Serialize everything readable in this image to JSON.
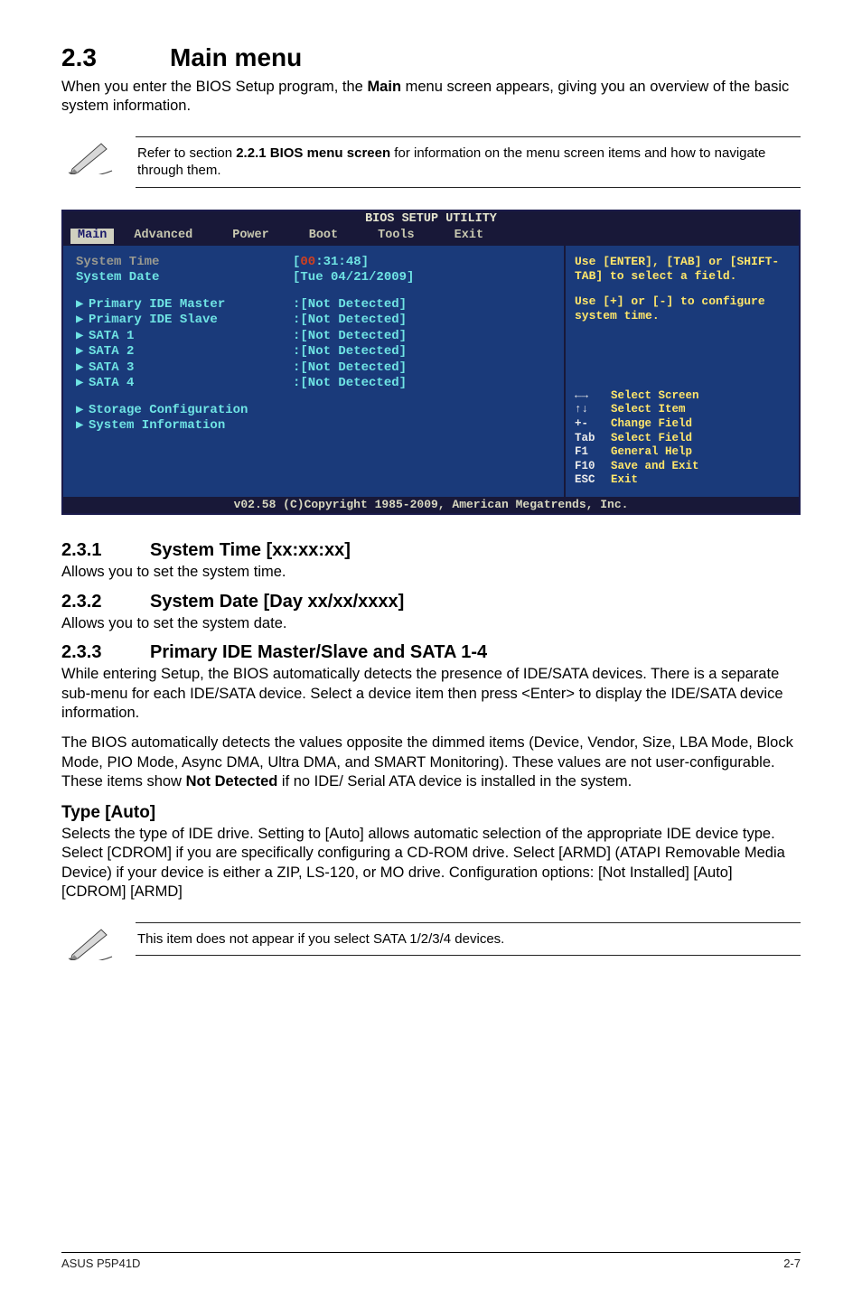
{
  "heading": {
    "num": "2.3",
    "title": "Main menu"
  },
  "intro": "When you enter the BIOS Setup program, the ",
  "intro_bold": "Main",
  "intro_tail": " menu screen appears, giving you an overview of the basic system information.",
  "note1_a": "Refer to section ",
  "note1_b": "2.2.1 BIOS menu screen",
  "note1_c": " for information on the menu screen items and how to navigate through them.",
  "bios": {
    "title": "BIOS SETUP UTILITY",
    "tabs": [
      "Main",
      "Advanced",
      "Power",
      "Boot",
      "Tools",
      "Exit"
    ],
    "sys_time_label": "System Time",
    "sys_date_label": "System Date",
    "sys_time_val_open": "[",
    "sys_time_val_hh": "00",
    "sys_time_val_rest": ":31:48]",
    "sys_date_val": "[Tue 04/21/2009]",
    "items": [
      {
        "label": "Primary IDE Master",
        "val": ":[Not Detected]"
      },
      {
        "label": "Primary IDE Slave",
        "val": ":[Not Detected]"
      },
      {
        "label": "SATA 1",
        "val": ":[Not Detected]"
      },
      {
        "label": "SATA 2",
        "val": ":[Not Detected]"
      },
      {
        "label": "SATA 3",
        "val": ":[Not Detected]"
      },
      {
        "label": "SATA 4",
        "val": ":[Not Detected]"
      }
    ],
    "storage": "Storage Configuration",
    "sysinfo": "System Information",
    "help1": "Use [ENTER], [TAB] or [SHIFT-TAB] to select a field.",
    "help2": "Use [+] or [-] to configure system time.",
    "nav": [
      {
        "k": "←→",
        "t": "Select Screen"
      },
      {
        "k": "↑↓",
        "t": "Select Item"
      },
      {
        "k": "+-",
        "t": "Change Field"
      },
      {
        "k": "Tab",
        "t": "Select Field"
      },
      {
        "k": "F1",
        "t": "General Help"
      },
      {
        "k": "F10",
        "t": "Save and Exit"
      },
      {
        "k": "ESC",
        "t": "Exit"
      }
    ],
    "foot": "v02.58 (C)Copyright 1985-2009, American Megatrends, Inc."
  },
  "s231": {
    "n": "2.3.1",
    "t": "System Time [xx:xx:xx]",
    "p": "Allows you to set the system time."
  },
  "s232": {
    "n": "2.3.2",
    "t": "System Date [Day xx/xx/xxxx]",
    "p": "Allows you to set the system date."
  },
  "s233": {
    "n": "2.3.3",
    "t": "Primary IDE Master/Slave and SATA 1-4",
    "p1": "While entering Setup, the BIOS automatically detects the presence of IDE/SATA devices. There is a separate sub-menu for each IDE/SATA device. Select a device item then press <Enter> to display the IDE/SATA device information.",
    "p2a": "The BIOS automatically detects the values opposite the dimmed items (Device, Vendor, Size, LBA Mode, Block Mode, PIO Mode, Async DMA, Ultra DMA, and SMART Monitoring). These values are not user-configurable. These items show ",
    "p2b": "Not Detected",
    "p2c": " if no IDE/ Serial ATA device is installed in the system."
  },
  "type": {
    "h": "Type [Auto]",
    "p": "Selects the type of IDE drive. Setting to [Auto] allows automatic selection of the appropriate IDE device type. Select [CDROM] if you are specifically configuring a CD-ROM drive. Select [ARMD] (ATAPI Removable Media Device) if your device is either a ZIP, LS-120, or MO drive. Configuration options: [Not Installed] [Auto] [CDROM] [ARMD]"
  },
  "note2": "This item does not appear if you select SATA 1/2/3/4 devices.",
  "footer": {
    "left": "ASUS P5P41D",
    "right": "2-7"
  }
}
